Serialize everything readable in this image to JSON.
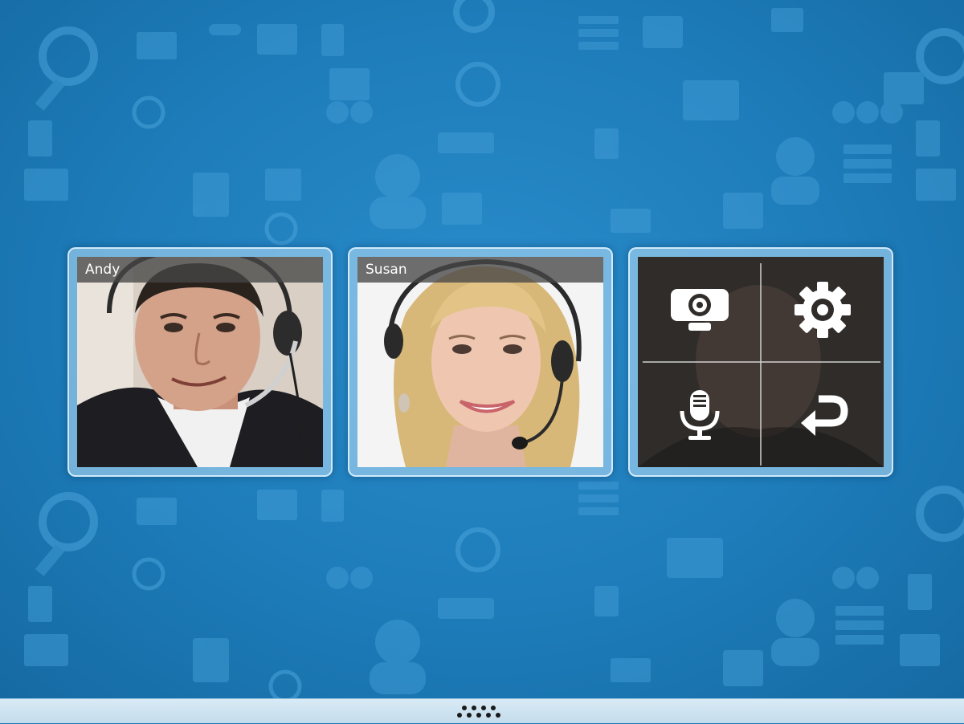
{
  "participants": [
    {
      "name": "Andy"
    },
    {
      "name": "Susan"
    }
  ],
  "controls": {
    "camera_icon": "webcam-icon",
    "settings_icon": "gear-icon",
    "microphone_icon": "microphone-icon",
    "back_icon": "return-arrow-icon"
  },
  "footer": {
    "handle_icon": "dots-handle-icon"
  },
  "colors": {
    "background": "#1d7cb9",
    "tile_border": "#e1f3ff",
    "name_bar": "#464646",
    "footer": "#d0e5f2"
  }
}
